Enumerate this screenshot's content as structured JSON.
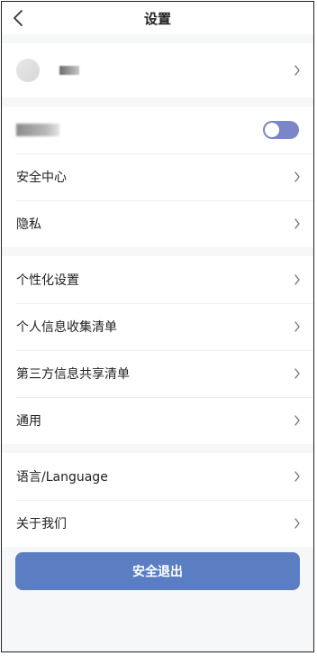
{
  "header": {
    "title": "设置",
    "back_icon": "chevron-left-icon"
  },
  "profile": {
    "avatar": "avatar"
  },
  "toggle_row": {
    "state": "on",
    "accent": "#7b86c9"
  },
  "group1": {
    "items": [
      {
        "label": "安全中心"
      },
      {
        "label": "隐私"
      }
    ]
  },
  "group2": {
    "items": [
      {
        "label": "个性化设置"
      },
      {
        "label": "个人信息收集清单"
      },
      {
        "label": "第三方信息共享清单"
      },
      {
        "label": "通用"
      }
    ]
  },
  "group3": {
    "items": [
      {
        "label": "语言/Language"
      },
      {
        "label": "关于我们"
      }
    ]
  },
  "logout": {
    "label": "安全退出",
    "color": "#5b7ec3"
  }
}
